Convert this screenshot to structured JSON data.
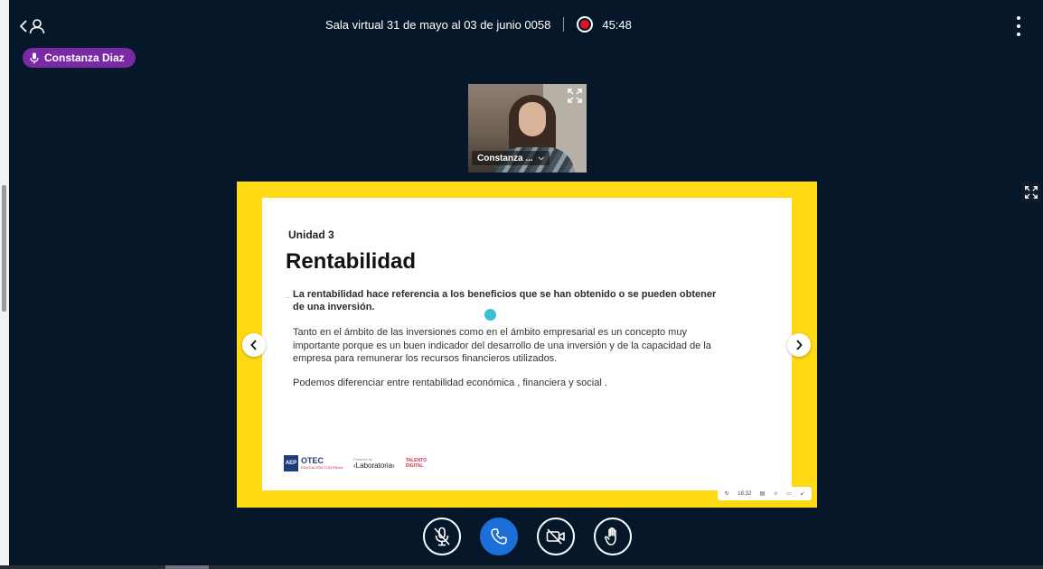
{
  "header": {
    "meeting_title": "Sala virtual 31 de mayo al 03 de junio 0058",
    "recording_time": "45:48"
  },
  "talking_indicator": {
    "name": "Constanza Diaz"
  },
  "webcam": {
    "participant_label": "Constanza ..."
  },
  "slide": {
    "unit": "Unidad 3",
    "title": "Rentabilidad",
    "bullet": "..",
    "definition": "La rentabilidad hace referencia a los beneficios que se han obtenido o se pueden obtener de una inversión.",
    "body_1": "Tanto en el ámbito de las inversiones como en el ámbito empresarial es un concepto muy importante porque es un buen indicador del desarrollo de una inversión y de la capacidad de la empresa para remunerar los recursos financieros utilizados.",
    "body_2": "Podemos diferenciar entre rentabilidad económica , financiera y social .",
    "logos": {
      "aep_block": "AEP",
      "otec": "OTEC",
      "otec_sub": "EDUCACIÓN CONTINUA",
      "lab_pre": "Powered by",
      "laboratoria": "‹Laboratoria›",
      "talento": "TALENTO DIGITAL"
    },
    "toolbar_time": "18:32"
  },
  "colors": {
    "background": "#06172a",
    "accent_purple": "#7b2aa6",
    "presentation_frame": "#ffd914",
    "phone_button": "#1b6fd6",
    "record_red": "#e0141e"
  }
}
